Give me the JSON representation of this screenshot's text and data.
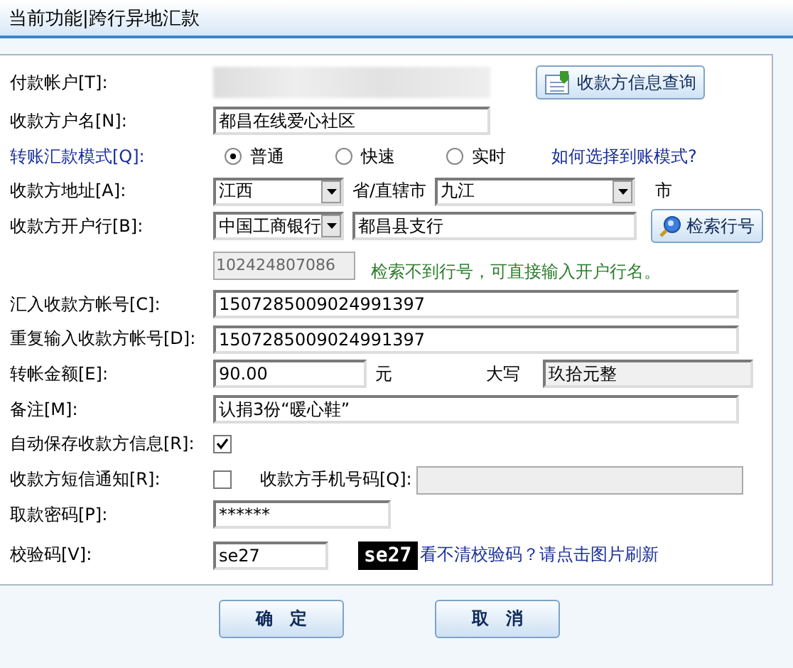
{
  "header": {
    "title": "当前功能|跨行异地汇款"
  },
  "rows": [
    {
      "kind": "blurred",
      "label": "付款帐户[T]:",
      "button": "收款方信息查询"
    },
    {
      "kind": "text",
      "label": "收款方户名[N]:",
      "value": "都昌在线爱心社区"
    },
    {
      "kind": "radio",
      "label": "转账汇款模式[Q]:",
      "options": [
        {
          "label": "普通",
          "selected": true
        },
        {
          "label": "快速",
          "selected": false
        },
        {
          "label": "实时",
          "selected": false
        }
      ],
      "link": "如何选择到账模式?"
    },
    {
      "kind": "address",
      "label": "收款方地址[A]:",
      "province": "江西",
      "province_unit": "省/直辖市",
      "city": "九江",
      "city_unit": "市"
    },
    {
      "kind": "bank",
      "label": "收款方开户行[B]:",
      "bank": "中国工商银行",
      "branch": "都昌县支行",
      "button": "检索行号"
    },
    {
      "kind": "code",
      "value": "102424807086",
      "hint": "检索不到行号，可直接输入开户行名。"
    },
    {
      "kind": "wide",
      "label": "汇入收款方帐号[C]:",
      "value": "1507285009024991397"
    },
    {
      "kind": "wide",
      "label": "重复输入收款方帐号[D]:",
      "value": "1507285009024991397"
    },
    {
      "kind": "amount",
      "label": "转帐金额[E]:",
      "value": "90.00",
      "unit": "元",
      "words_label": "大写",
      "words": "玖拾元整"
    },
    {
      "kind": "wide",
      "label": "备注[M]:",
      "value": "认捐3份“暖心鞋”"
    },
    {
      "kind": "check",
      "label": "自动保存收款方信息[R]:",
      "checked": true
    },
    {
      "kind": "sms",
      "label": "收款方短信通知[R]:",
      "checked": false,
      "phone_label": "收款方手机号码[Q]:"
    },
    {
      "kind": "password",
      "label": "取款密码[P]:",
      "value": "******"
    },
    {
      "kind": "captcha",
      "label": "校验码[V]:",
      "value": "se27",
      "image_text": "se27",
      "link": "看不清校验码？请点击图片刷新"
    }
  ],
  "buttons": [
    "确　定",
    "取　消"
  ]
}
